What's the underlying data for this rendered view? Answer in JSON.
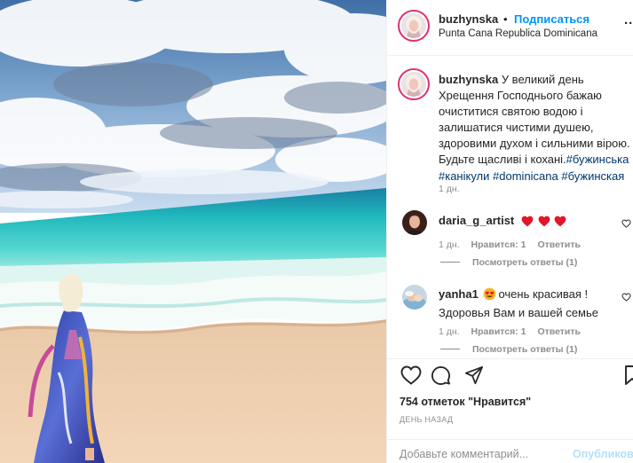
{
  "header": {
    "username": "buzhynska",
    "separator": "•",
    "follow_label": "Подписаться",
    "location": "Punta Cana Republica Dominicana",
    "more_label": "..."
  },
  "caption": {
    "username": "buzhynska",
    "text": "У великий день Хрещення Господнього бажаю очиститися святою водою і залишатися чистими душею, здоровими духом і сильними вірою. Будьте щасливі і кохані.",
    "hashtags": [
      "#бужинська",
      "#канікули",
      "#dominicana",
      "#бужинская"
    ],
    "time": "1 дн."
  },
  "comments": [
    {
      "username": "daria_g_artist",
      "text": "",
      "emoji": [
        "red-heart",
        "red-heart",
        "red-heart"
      ],
      "time": "1 дн.",
      "likes": "Нравится: 1",
      "reply": "Ответить",
      "replies": "Посмотреть ответы (1)"
    },
    {
      "username": "yanha1",
      "emoji": [
        "heart-eyes"
      ],
      "text": "очень красивая ! Здоровья Вам и вашей семье",
      "time": "1 дн.",
      "likes": "Нравится: 1",
      "reply": "Ответить",
      "replies": "Посмотреть ответы (1)"
    }
  ],
  "actions": {
    "likes": "754 отметок \"Нравится\"",
    "date": "ДЕНЬ НАЗАД"
  },
  "comment_box": {
    "placeholder": "Добавьте комментарий...",
    "publish_label": "Опубликовать"
  },
  "colors": {
    "link": "#0095f6",
    "hashtag": "#00376b",
    "muted": "#8e8e8e",
    "heart": "#ed4956",
    "publish_disabled": "#b2dffc"
  },
  "icons": [
    "heart-icon",
    "comment-icon",
    "share-icon",
    "bookmark-icon",
    "more-icon"
  ]
}
